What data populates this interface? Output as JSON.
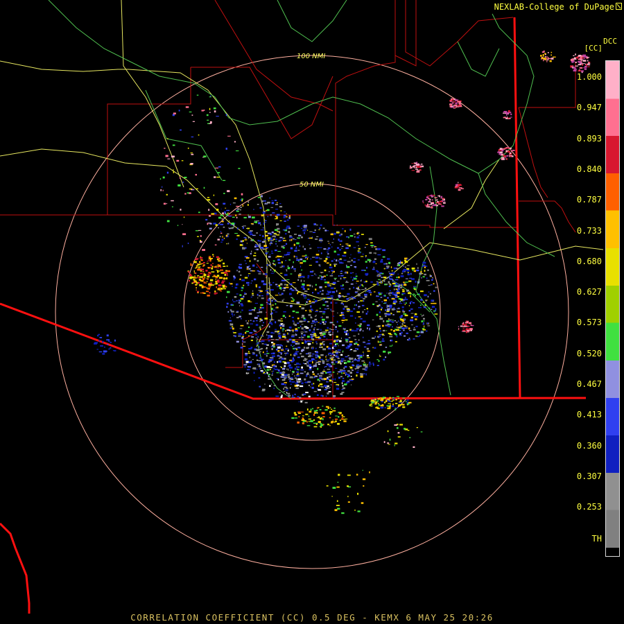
{
  "header": {
    "credit": "NEXLAB-College of DuPage"
  },
  "caption": "CORRELATION COEFFICIENT (CC) 0.5 DEG - KEMX 6 MAY 25 20:26",
  "rings": [
    {
      "label": "50 NMI"
    },
    {
      "label": "100 NMI"
    }
  ],
  "legend": {
    "product": "DCC",
    "unit": "[CC]",
    "ticks": [
      "1.000",
      "0.947",
      "0.893",
      "0.840",
      "0.787",
      "0.733",
      "0.680",
      "0.627",
      "0.573",
      "0.520",
      "0.467",
      "0.413",
      "0.360",
      "0.307",
      "0.253",
      "TH"
    ],
    "colors": [
      "#ffb0c8",
      "#ff7090",
      "#d81830",
      "#ff6000",
      "#ffc000",
      "#e8e000",
      "#a0d000",
      "#40e040",
      "#9090e0",
      "#3040f0",
      "#1020c0",
      "#909090",
      "#808080"
    ]
  },
  "colors": {
    "state_border": "#ff1010",
    "county_border": "#c01010",
    "highway": "#e8e860",
    "river": "#50c050",
    "range_ring": "#ffb0a0"
  }
}
